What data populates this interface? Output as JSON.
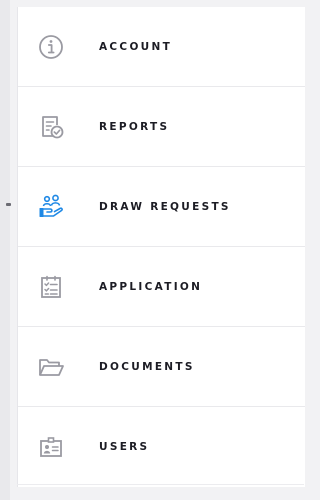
{
  "menu": {
    "items": [
      {
        "label": "ACCOUNT",
        "icon": "info-circle-icon"
      },
      {
        "label": "REPORTS",
        "icon": "report-check-icon"
      },
      {
        "label": "DRAW REQUESTS",
        "icon": "hand-people-icon"
      },
      {
        "label": "APPLICATION",
        "icon": "checklist-icon"
      },
      {
        "label": "DOCUMENTS",
        "icon": "folder-open-icon"
      },
      {
        "label": "USERS",
        "icon": "id-badge-icon"
      }
    ]
  },
  "colors": {
    "icon_gray": "#9a9aa2",
    "icon_accent": "#1e88e5",
    "label": "#1c1c24",
    "divider": "#e9e9ec"
  }
}
